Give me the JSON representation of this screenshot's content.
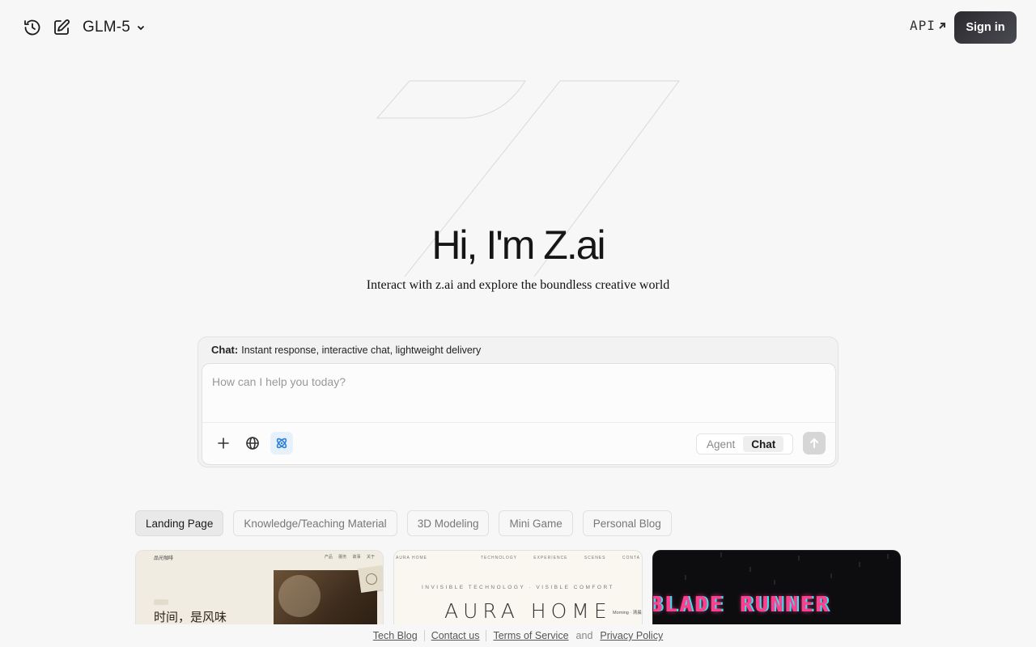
{
  "header": {
    "history_icon": "history-icon",
    "new_chat_icon": "edit-icon",
    "model_name": "GLM-5",
    "api_label": "API",
    "signin_label": "Sign in"
  },
  "hero": {
    "title": "Hi, I'm Z.ai",
    "subtitle": "Interact with z.ai and explore the boundless creative world"
  },
  "chat": {
    "mode_name": "Chat:",
    "mode_description": "Instant response, interactive chat, lightweight delivery",
    "placeholder": "How can I help you today?",
    "tools": [
      "plus-icon",
      "globe-icon",
      "atom-icon"
    ],
    "modes": [
      "Agent",
      "Chat"
    ],
    "selected_mode": "Chat",
    "accent_color": "#2f7fd8"
  },
  "categories": {
    "items": [
      "Landing Page",
      "Knowledge/Teaching Material",
      "3D Modeling",
      "Mini Game",
      "Personal Blog"
    ],
    "selected": "Landing Page"
  },
  "previews": {
    "card1": {
      "logo": "品光咖啡",
      "nav": "产品 服务 故事 关于",
      "text": "时间，是风味"
    },
    "card2": {
      "brand": "AURA HOME",
      "nav": "TECHNOLOGY EXPERIENCE SCENES CONTA",
      "tagline": "INVISIBLE TECHNOLOGY · VISIBLE COMFORT",
      "title": "AURA HOME",
      "side_text": "Morning · 清晨"
    },
    "card3": {
      "title": "BLADE RUNNER"
    }
  },
  "footer": {
    "links": [
      "Tech Blog",
      "Contact us",
      "Terms of Service",
      "Privacy Policy"
    ],
    "and_text": "and"
  }
}
